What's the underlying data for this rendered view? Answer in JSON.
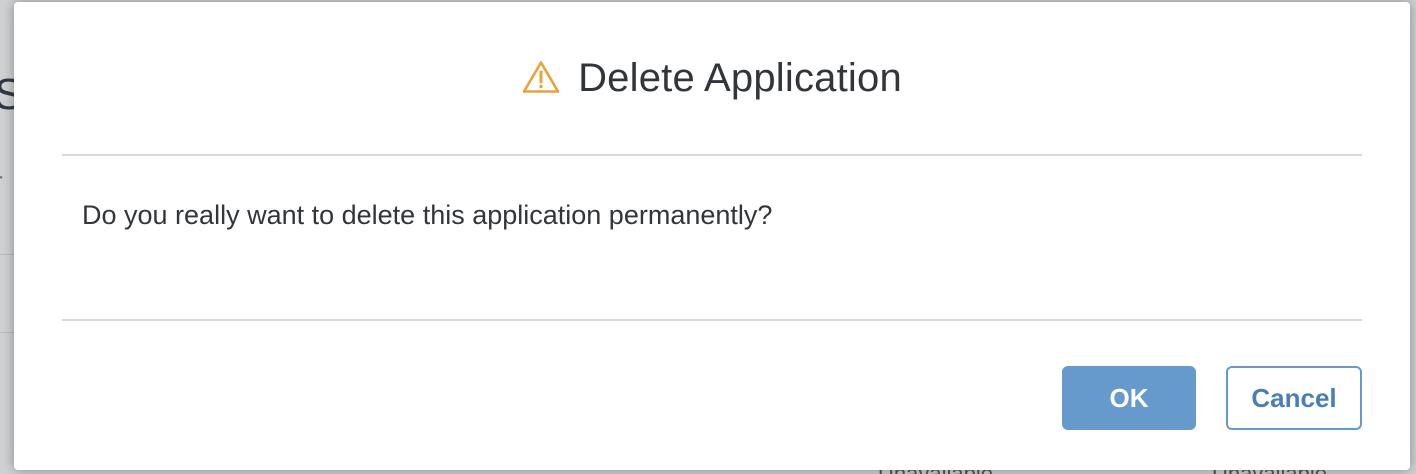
{
  "background": {
    "title_fragment": "S",
    "subtitle_fragment": "r",
    "status_cells": [
      "Unavailable",
      "Unavailable"
    ]
  },
  "dialog": {
    "icon": "warning-triangle-icon",
    "icon_color": "#e9a23b",
    "title": "Delete Application",
    "message": "Do you really want to delete this application permanently?",
    "buttons": {
      "ok_label": "OK",
      "cancel_label": "Cancel"
    },
    "colors": {
      "primary": "#6699cc",
      "text": "#32363a"
    }
  }
}
